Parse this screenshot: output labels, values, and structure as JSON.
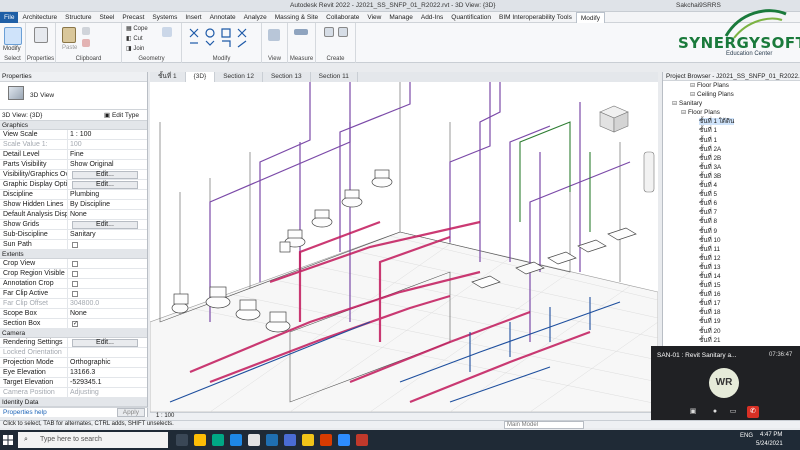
{
  "app": {
    "title": "Autodesk Revit 2022 - J2021_SS_SNFP_01_R2022.rvt - 3D View: {3D}",
    "user": "Sakchai9SRRS"
  },
  "ribbon": {
    "tabs": [
      "File",
      "Architecture",
      "Structure",
      "Steel",
      "Precast",
      "Systems",
      "Insert",
      "Annotate",
      "Analyze",
      "Massing & Site",
      "Collaborate",
      "View",
      "Manage",
      "Add-Ins",
      "Quantification",
      "BIM Interoperability Tools",
      "Modify"
    ],
    "active_tab": "Modify",
    "groups": {
      "select": "Select",
      "properties": "Properties",
      "clipboard": "Clipboard",
      "geometry": "Geometry",
      "modify": "Modify",
      "view": "View",
      "measure": "Measure",
      "create": "Create"
    },
    "buttons": {
      "modify": "Modify",
      "paste": "Paste",
      "cope": "Cope",
      "cut": "Cut",
      "join": "Join"
    }
  },
  "logo": {
    "name": "SYNERGYSOFT",
    "subtitle": "Education Center"
  },
  "properties": {
    "title": "Properties",
    "type_name": "3D View",
    "selector": "3D View: {3D}",
    "edit_type": "Edit Type",
    "sections": {
      "graphics": "Graphics",
      "extents": "Extents",
      "camera": "Camera",
      "identity": "Identity Data"
    },
    "graphics_rows": [
      {
        "k": "View Scale",
        "v": "1 : 100",
        "dim": false
      },
      {
        "k": "Scale Value    1:",
        "v": "100",
        "dim": true
      },
      {
        "k": "Detail Level",
        "v": "Fine",
        "dim": false
      },
      {
        "k": "Parts Visibility",
        "v": "Show Original",
        "dim": false
      },
      {
        "k": "Visibility/Graphics Ov...",
        "v": "Edit...",
        "dim": false,
        "button": true
      },
      {
        "k": "Graphic Display Opti...",
        "v": "Edit...",
        "dim": false,
        "button": true
      },
      {
        "k": "Discipline",
        "v": "Plumbing",
        "dim": false
      },
      {
        "k": "Show Hidden Lines",
        "v": "By Discipline",
        "dim": false
      },
      {
        "k": "Default Analysis Disp...",
        "v": "None",
        "dim": false
      },
      {
        "k": "Show Grids",
        "v": "Edit...",
        "dim": false,
        "button": true
      },
      {
        "k": "Sub-Discipline",
        "v": "Sanitary",
        "dim": false
      },
      {
        "k": "Sun Path",
        "v": "",
        "dim": false,
        "check": false
      }
    ],
    "extents_rows": [
      {
        "k": "Crop View",
        "v": "",
        "check": false
      },
      {
        "k": "Crop Region Visible",
        "v": "",
        "check": false
      },
      {
        "k": "Annotation Crop",
        "v": "",
        "check": false
      },
      {
        "k": "Far Clip Active",
        "v": "",
        "check": false
      },
      {
        "k": "Far Clip Offset",
        "v": "304800.0",
        "dim": true
      },
      {
        "k": "Scope Box",
        "v": "None"
      },
      {
        "k": "Section Box",
        "v": "",
        "check": true
      }
    ],
    "camera_rows": [
      {
        "k": "Rendering Settings",
        "v": "Edit...",
        "button": true
      },
      {
        "k": "Locked Orientation",
        "v": "",
        "dim": true
      },
      {
        "k": "Projection Mode",
        "v": "Orthographic"
      },
      {
        "k": "Eye Elevation",
        "v": "13166.3"
      },
      {
        "k": "Target Elevation",
        "v": "-529345.1"
      },
      {
        "k": "Camera Position",
        "v": "Adjusting",
        "dim": true
      }
    ],
    "help_link": "Properties help",
    "apply": "Apply"
  },
  "view_tabs": [
    "ชั้นที่ 1",
    "{3D}",
    "Section 12",
    "Section 13",
    "Section 11"
  ],
  "active_view_tab": 1,
  "viewbar": {
    "scale": "1 : 100"
  },
  "browser": {
    "title": "Project Browser - J2021_SS_SNFP_01_R2022.rvt",
    "nodes": [
      {
        "label": "Floor Plans",
        "indent": 3
      },
      {
        "label": "Ceiling Plans",
        "indent": 3
      },
      {
        "label": "Sanitary",
        "indent": 1
      },
      {
        "label": "Floor Plans",
        "indent": 2
      },
      {
        "label": "ชั้นที่ 1 ใต้ดิน",
        "indent": 4,
        "sel": true
      },
      {
        "label": "ชั้นที่ 1",
        "indent": 4
      },
      {
        "label": "ชั้นที่ 1",
        "indent": 4
      },
      {
        "label": "ชั้นที่ 2A",
        "indent": 4
      },
      {
        "label": "ชั้นที่ 2B",
        "indent": 4
      },
      {
        "label": "ชั้นที่ 3A",
        "indent": 4
      },
      {
        "label": "ชั้นที่ 3B",
        "indent": 4
      },
      {
        "label": "ชั้นที่ 4",
        "indent": 4
      },
      {
        "label": "ชั้นที่ 5",
        "indent": 4
      },
      {
        "label": "ชั้นที่ 6",
        "indent": 4
      },
      {
        "label": "ชั้นที่ 7",
        "indent": 4
      },
      {
        "label": "ชั้นที่ 8",
        "indent": 4
      },
      {
        "label": "ชั้นที่ 9",
        "indent": 4
      },
      {
        "label": "ชั้นที่ 10",
        "indent": 4
      },
      {
        "label": "ชั้นที่ 11",
        "indent": 4
      },
      {
        "label": "ชั้นที่ 12",
        "indent": 4
      },
      {
        "label": "ชั้นที่ 13",
        "indent": 4
      },
      {
        "label": "ชั้นที่ 14",
        "indent": 4
      },
      {
        "label": "ชั้นที่ 15",
        "indent": 4
      },
      {
        "label": "ชั้นที่ 16",
        "indent": 4
      },
      {
        "label": "ชั้นที่ 17",
        "indent": 4
      },
      {
        "label": "ชั้นที่ 18",
        "indent": 4
      },
      {
        "label": "ชั้นที่ 19",
        "indent": 4
      },
      {
        "label": "ชั้นที่ 20",
        "indent": 4
      },
      {
        "label": "ชั้นที่ 21",
        "indent": 4
      }
    ]
  },
  "meeting": {
    "title": "SAN-01 : Revit Sanitary a...",
    "time": "07:36:47",
    "initials": "WR"
  },
  "status": {
    "hint": "Click to select, TAB for alternates, CTRL adds, SHIFT unselects.",
    "model": "Main Model"
  },
  "taskbar": {
    "search_placeholder": "Type here to search",
    "time": "4:47 PM",
    "date": "5/24/2021",
    "lang": "ENG"
  },
  "colors": {
    "file_tab": "#1f5fa6",
    "sanitary_pipe": "#c2185b",
    "vent_pipe": "#7b4aa8",
    "water_pipe": "#2e7d32",
    "logo_green": "#1a7a3b",
    "meeting_bg": "#202124"
  }
}
